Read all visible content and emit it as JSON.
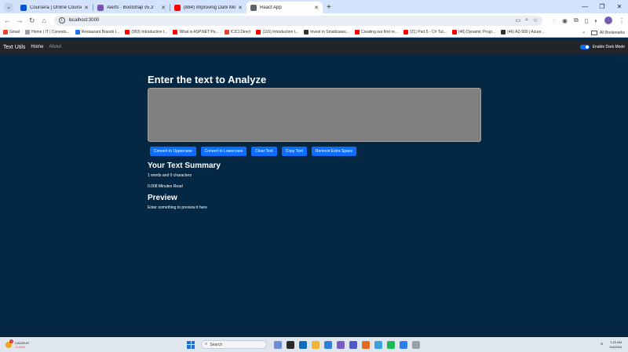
{
  "browser": {
    "tabs": [
      {
        "title": "Coursera | Online Courses From",
        "color": "#0056d2",
        "active": false
      },
      {
        "title": "Alerts · Bootstrap v5.3",
        "color": "#7952b3",
        "active": false
      },
      {
        "title": "(884) Improving Dark Mode S",
        "color": "#ff0000",
        "active": false
      },
      {
        "title": "React App",
        "color": "#5f6368",
        "active": true
      }
    ],
    "url": "localhost:3000",
    "bookmarks": [
      {
        "label": "Gmail",
        "color": "#ea4335"
      },
      {
        "label": "Home | IT | Conesto...",
        "color": "#9aa0a6"
      },
      {
        "label": "Restaurant Brands I...",
        "color": "#1a73e8"
      },
      {
        "label": "(993) Introduction t...",
        "color": "#ff0000"
      },
      {
        "label": "What is ASP.NET Pa...",
        "color": "#ff0000"
      },
      {
        "label": "ICICI Direct",
        "color": "#e8412c"
      },
      {
        "label": "(116) Introduction t...",
        "color": "#ff0000"
      },
      {
        "label": "Invest in Smallcases...",
        "color": "#333333"
      },
      {
        "label": "Creating our first re...",
        "color": "#ff0000"
      },
      {
        "label": "(21) Part 5 - C# Tut...",
        "color": "#ff0000"
      },
      {
        "label": "(46) Dynamic Progr...",
        "color": "#ff0000"
      },
      {
        "label": "(46) AZ-900 | Azure...",
        "color": "#333333"
      }
    ],
    "all_bookmarks": "All Bookmarks"
  },
  "navbar": {
    "brand": "Text Utils",
    "links": [
      "Home",
      "About"
    ],
    "dark_mode_label": "Enable Dark Mode"
  },
  "main": {
    "heading": "Enter the text to Analyze",
    "textarea_value": "",
    "buttons": [
      "Convert to Uppercase",
      "Convert to Lowercase",
      "Clear Text",
      "Copy Text",
      "Remove Extra Space"
    ],
    "summary_heading": "Your Text Summary",
    "word_char_text": "1 words and 0 characters",
    "minutes_text": "0.008 Minutes Read",
    "preview_heading": "Preview",
    "preview_text": "Enter something to preview it here"
  },
  "taskbar": {
    "weather_title": "CAD/EUR",
    "weather_value": "-0.41%",
    "weather_badge": "1",
    "search_placeholder": "Search",
    "time": "1:23 AM",
    "date": "3/4/2024",
    "apps": [
      "#6b8fd6",
      "#2a2a2a",
      "#0f6cbd",
      "#f2b632",
      "#2f7fd8",
      "#7a5cc7",
      "#5059c9",
      "#e36a1e",
      "#3aa0e0",
      "#1db954",
      "#2b7de9",
      "#9aa0a6"
    ]
  },
  "colors": {
    "page_bg": "#042743",
    "button_primary": "#0d6efd",
    "textarea_bg": "#808080",
    "navbar_bg": "#212529"
  }
}
